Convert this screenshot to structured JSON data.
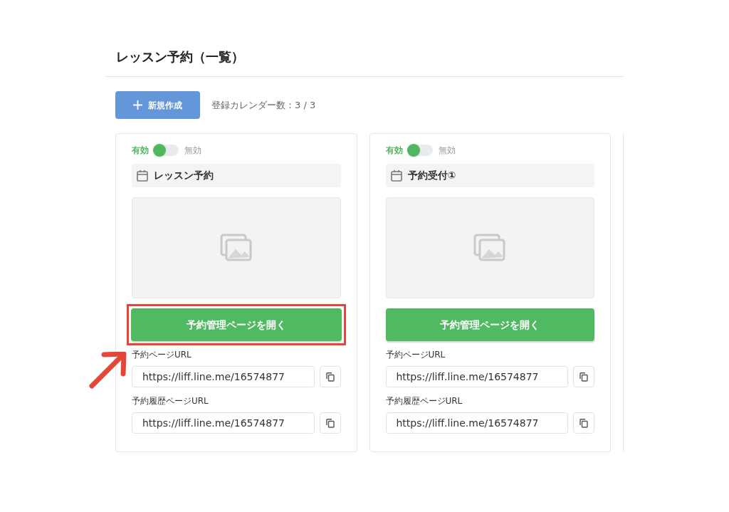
{
  "title": "レッスン予約（一覧）",
  "toolbar": {
    "new_button": "新規作成",
    "count_label": "登録カレンダー数：3 / 3"
  },
  "cards": [
    {
      "enabled_label": "有効",
      "disabled_label": "無効",
      "disabled": false,
      "name": "レッスン予約",
      "open_button": {
        "label": "予約管理ページを開く",
        "highlighted": true
      },
      "fields": [
        {
          "label": "予約ページURL",
          "value": "https://liff.line.me/16574877"
        },
        {
          "label": "予約履歴ページURL",
          "value": "https://liff.line.me/16574877"
        }
      ]
    },
    {
      "enabled_label": "有効",
      "disabled_label": "無効",
      "disabled": false,
      "name": "予約受付①",
      "open_button": {
        "label": "予約管理ページを開く",
        "highlighted": false
      },
      "fields": [
        {
          "label": "予約ページURL",
          "value": "https://liff.line.me/16574877"
        },
        {
          "label": "予約履歴ページURL",
          "value": "https://liff.line.me/16574877"
        }
      ]
    }
  ]
}
